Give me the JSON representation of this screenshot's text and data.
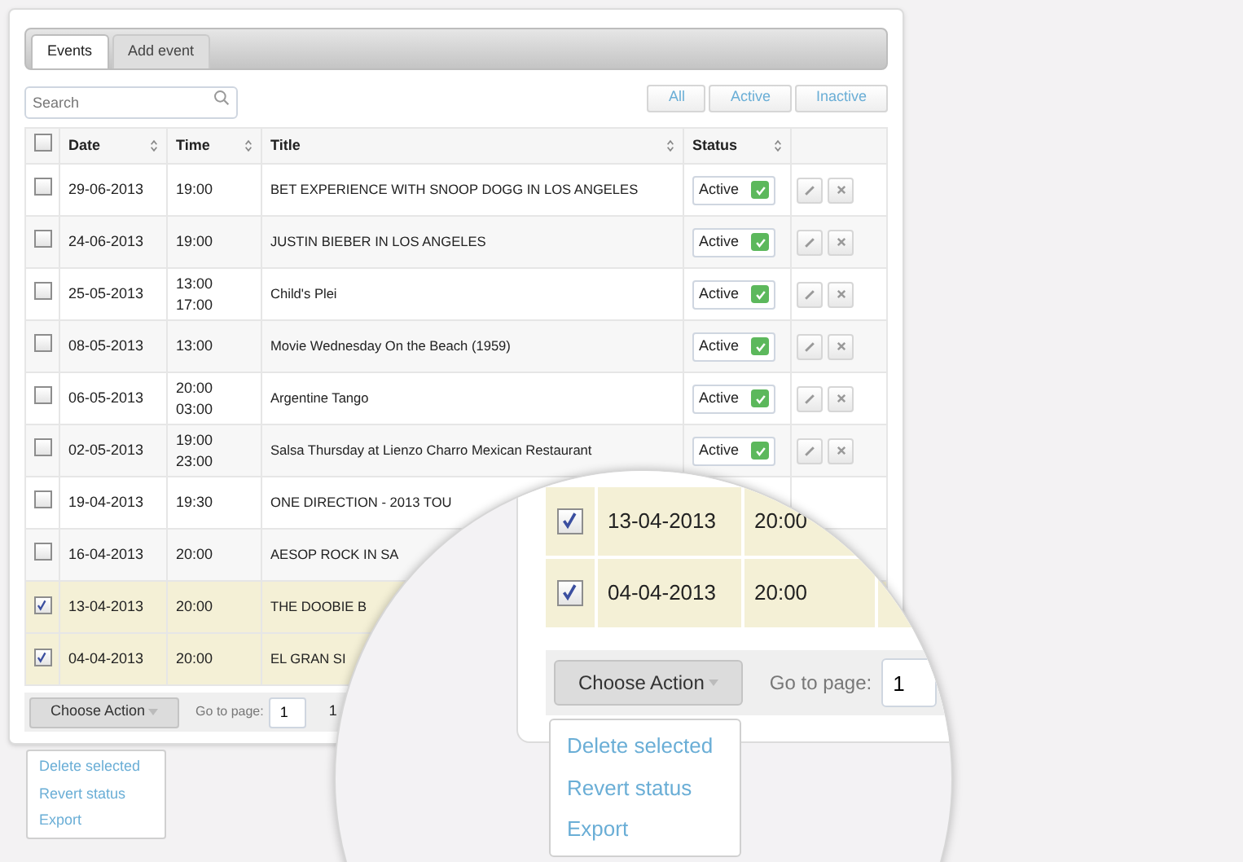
{
  "tabs": [
    {
      "label": "Events",
      "selected": true
    },
    {
      "label": "Add event",
      "selected": false
    }
  ],
  "search": {
    "placeholder": "Search"
  },
  "filters": [
    "All",
    "Active",
    "Inactive"
  ],
  "table": {
    "select_all": {
      "checked": false
    },
    "columns": [
      "Date",
      "Time",
      "Title",
      "Status"
    ],
    "rows": [
      {
        "checked": false,
        "date": "29-06-2013",
        "times": [
          "19:00"
        ],
        "title": "BET EXPERIENCE WITH SNOOP DOGG IN LOS ANGELES",
        "status": "Active",
        "active": true
      },
      {
        "checked": false,
        "date": "24-06-2013",
        "times": [
          "19:00"
        ],
        "title": "JUSTIN BIEBER IN LOS ANGELES",
        "status": "Active",
        "active": true
      },
      {
        "checked": false,
        "date": "25-05-2013",
        "times": [
          "13:00",
          "17:00"
        ],
        "title": "Child's Plei",
        "status": "Active",
        "active": true
      },
      {
        "checked": false,
        "date": "08-05-2013",
        "times": [
          "13:00"
        ],
        "title": "Movie Wednesday On the Beach (1959)",
        "status": "Active",
        "active": true
      },
      {
        "checked": false,
        "date": "06-05-2013",
        "times": [
          "20:00",
          "03:00"
        ],
        "title": "Argentine Tango",
        "status": "Active",
        "active": true
      },
      {
        "checked": false,
        "date": "02-05-2013",
        "times": [
          "19:00",
          "23:00"
        ],
        "title": "Salsa Thursday at Lienzo Charro Mexican Restaurant",
        "status": "Active",
        "active": true
      },
      {
        "checked": false,
        "date": "19-04-2013",
        "times": [
          "19:30"
        ],
        "title": "ONE DIRECTION - 2013 TOU"
      },
      {
        "checked": false,
        "date": "16-04-2013",
        "times": [
          "20:00"
        ],
        "title": "AESOP ROCK IN SA"
      },
      {
        "checked": true,
        "date": "13-04-2013",
        "times": [
          "20:00"
        ],
        "title": "THE DOOBIE B"
      },
      {
        "checked": true,
        "date": "04-04-2013",
        "times": [
          "20:00"
        ],
        "title": "EL GRAN SI"
      }
    ]
  },
  "footer": {
    "action_button": "Choose Action",
    "go_to_label": "Go to page:",
    "page_value": "1",
    "page_number": "1"
  },
  "action_menu": [
    "Delete selected",
    "Revert status",
    "Export"
  ],
  "magnifier": {
    "rows": [
      {
        "checked": true,
        "date": "13-04-2013",
        "time": "20:00"
      },
      {
        "checked": true,
        "date": "04-04-2013",
        "time": "20:00"
      }
    ],
    "action_button": "Choose Action",
    "go_to_label": "Go to page:",
    "page_value": "1",
    "menu": [
      "Delete selected",
      "Revert status",
      "Export"
    ]
  }
}
